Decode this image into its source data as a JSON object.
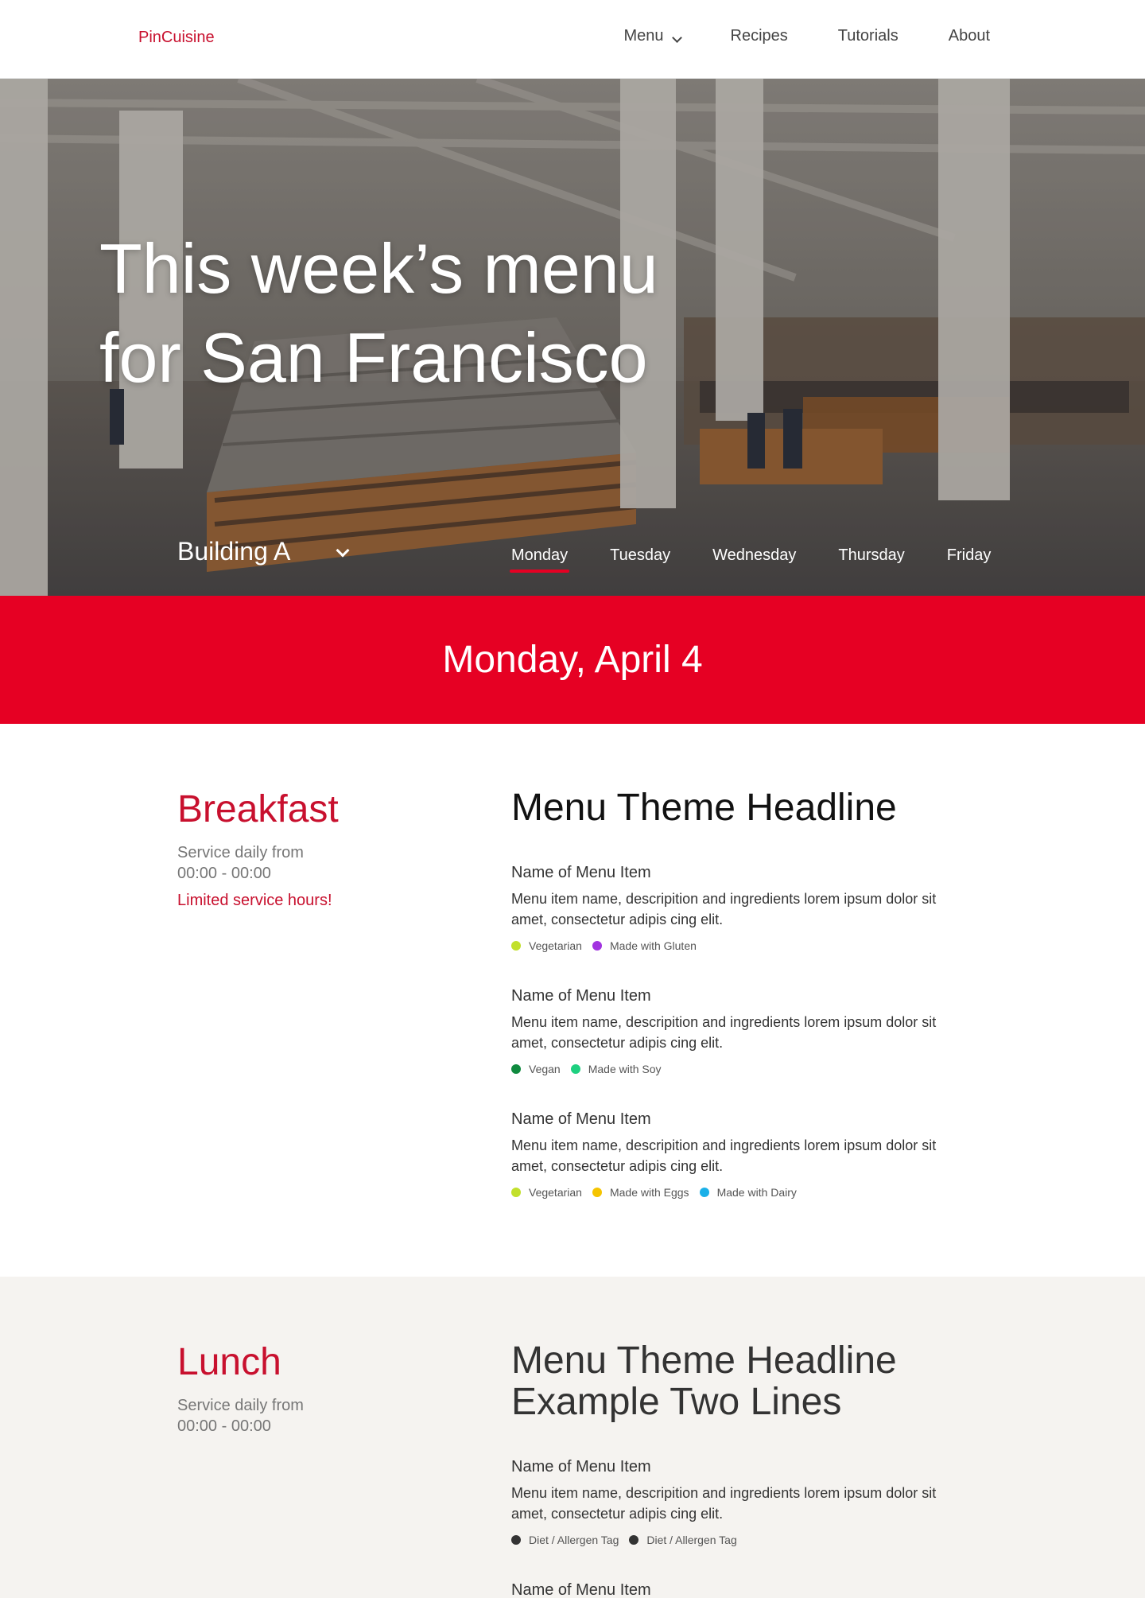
{
  "nav": {
    "brand": "PinCuisine",
    "links": [
      "Menu",
      "Recipes",
      "Tutorials",
      "About"
    ]
  },
  "hero": {
    "title_line1": "This week’s menu",
    "title_line2": "for San Francisco",
    "building": "Building A",
    "days": [
      "Monday",
      "Tuesday",
      "Wednesday",
      "Thursday",
      "Friday"
    ],
    "active_day": "Monday"
  },
  "date_banner": "Monday, April 4",
  "breakfast": {
    "title": "Breakfast",
    "service_line1": "Service daily from",
    "service_line2": "00:00 - 00:00",
    "notice": "Limited service hours!",
    "theme": "Menu Theme Headline",
    "items": [
      {
        "name": "Name of Menu Item",
        "desc": "Menu item name, descripition and ingredients lorem ipsum dolor sit amet, consectetur adipis cing elit.",
        "tags": [
          {
            "label": "Vegetarian",
            "color": "#c2e02c"
          },
          {
            "label": "Made with Gluten",
            "color": "#a234e0"
          }
        ]
      },
      {
        "name": "Name of Menu Item",
        "desc": "Menu item name, descripition and ingredients lorem ipsum dolor sit amet, consectetur adipis cing elit.",
        "tags": [
          {
            "label": "Vegan",
            "color": "#0f8a3f"
          },
          {
            "label": "Made with Soy",
            "color": "#1ed080"
          }
        ]
      },
      {
        "name": "Name of Menu Item",
        "desc": "Menu item name, descripition and ingredients lorem ipsum dolor sit amet, consectetur adipis cing elit.",
        "tags": [
          {
            "label": "Vegetarian",
            "color": "#c2e02c"
          },
          {
            "label": "Made with Eggs",
            "color": "#f5c400"
          },
          {
            "label": "Made with Dairy",
            "color": "#1ab0e8"
          }
        ]
      }
    ]
  },
  "lunch": {
    "title": "Lunch",
    "service_line1": "Service daily from",
    "service_line2": "00:00 - 00:00",
    "theme_line1": "Menu Theme Headline",
    "theme_line2": "Example Two Lines",
    "items": [
      {
        "name": "Name of Menu Item",
        "desc": "Menu item name, descripition and ingredients lorem ipsum dolor sit amet, consectetur adipis cing elit.",
        "tags": [
          {
            "label": "Diet / Allergen Tag",
            "color": "#333333"
          },
          {
            "label": "Diet / Allergen Tag",
            "color": "#333333"
          }
        ]
      },
      {
        "name": "Name of Menu Item"
      }
    ]
  },
  "colors": {
    "accent": "#e60023",
    "brand": "#c8102e",
    "section_bg": "#f5f3f0"
  }
}
